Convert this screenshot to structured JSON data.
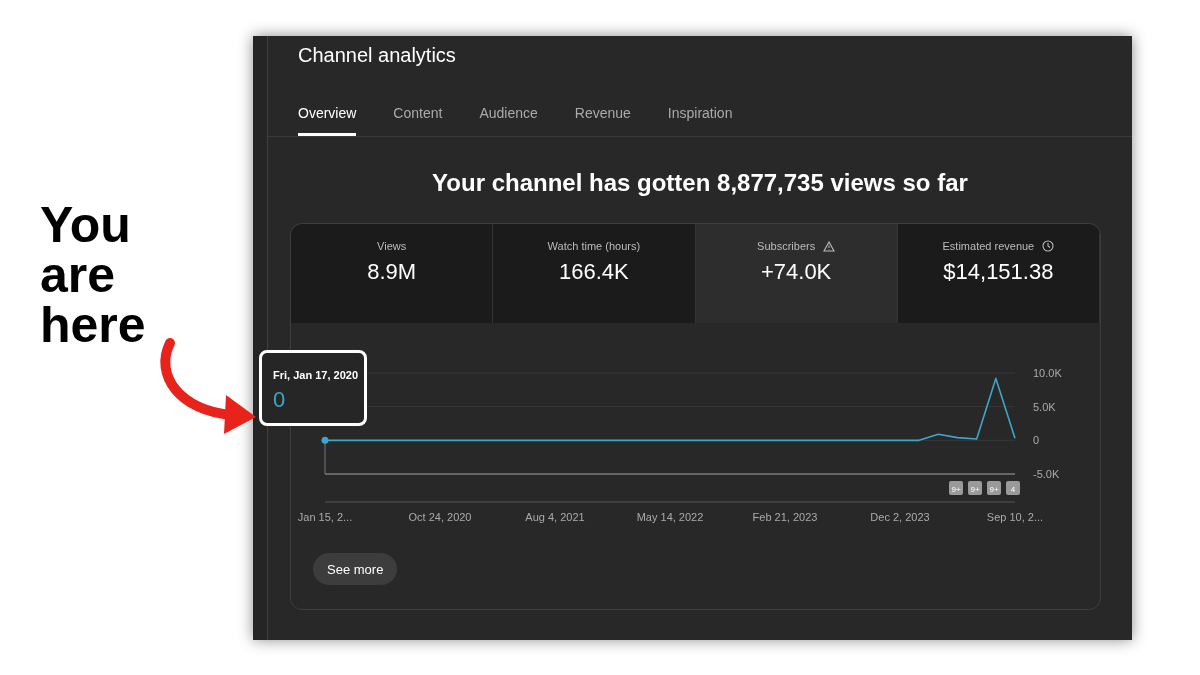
{
  "annotation": {
    "text": "You are here"
  },
  "window": {
    "title": "Channel analytics"
  },
  "tabs": [
    {
      "label": "Overview",
      "selected": true
    },
    {
      "label": "Content",
      "selected": false
    },
    {
      "label": "Audience",
      "selected": false
    },
    {
      "label": "Revenue",
      "selected": false
    },
    {
      "label": "Inspiration",
      "selected": false
    }
  ],
  "headline": "Your channel has gotten 8,877,735 views so far",
  "metrics": [
    {
      "label": "Views",
      "value": "8.9M",
      "kind": "plain",
      "selected": false
    },
    {
      "label": "Watch time (hours)",
      "value": "166.4K",
      "kind": "plain",
      "selected": false
    },
    {
      "label": "Subscribers",
      "value": "+74.0K",
      "kind": "warning",
      "selected": true
    },
    {
      "label": "Estimated revenue",
      "value": "$14,151.38",
      "kind": "clock",
      "selected": false
    }
  ],
  "tooltip": {
    "date": "Fri, Jan 17, 2020",
    "value": "0"
  },
  "chart": {
    "chart_data": {
      "type": "line",
      "ylim": [
        -5000,
        10000
      ],
      "categories": [
        "Jan 15, 2...",
        null,
        null,
        null,
        null,
        null,
        "Oct 24, 2020",
        null,
        null,
        null,
        null,
        null,
        "Aug 4, 2021",
        null,
        null,
        null,
        null,
        null,
        "May 14, 2022",
        null,
        null,
        null,
        null,
        null,
        "Feb 21, 2023",
        null,
        null,
        null,
        null,
        null,
        "Dec 2, 2023",
        null,
        null,
        null,
        null,
        null,
        "Sep 10, 2..."
      ],
      "yticks": [
        {
          "value": 10000,
          "label": "10.0K"
        },
        {
          "value": 5000,
          "label": "5.0K"
        },
        {
          "value": 0,
          "label": "0"
        },
        {
          "value": -5000,
          "label": "-5.0K"
        }
      ],
      "series": [
        {
          "color": "#3ea6c8",
          "values": [
            0,
            0,
            0,
            0,
            0,
            0,
            0,
            0,
            0,
            0,
            0,
            0,
            0,
            0,
            0,
            0,
            0,
            0,
            0,
            0,
            0,
            0,
            0,
            0,
            0,
            0,
            0,
            0,
            0,
            0,
            0,
            0,
            900,
            400,
            200,
            9200,
            300
          ]
        }
      ]
    },
    "markers": [
      "9+",
      "9+",
      "9+",
      "4"
    ]
  },
  "see_more": "See more"
}
